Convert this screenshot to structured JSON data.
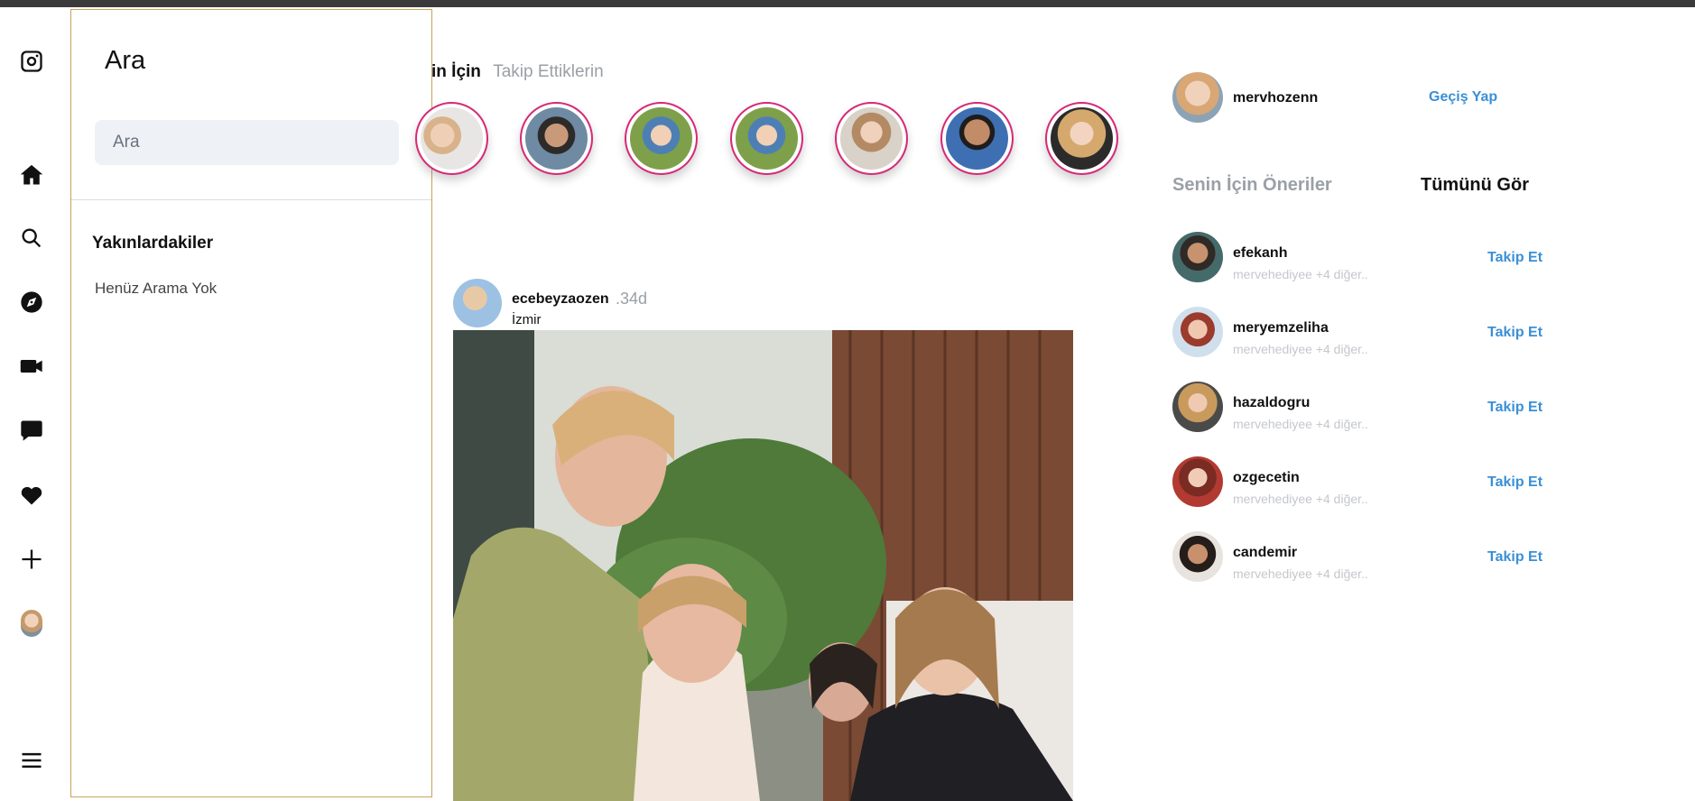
{
  "search_panel": {
    "title": "Ara",
    "search_placeholder": "Ara",
    "recent_title": "Yakınlardakiler",
    "recent_empty": "Henüz Arama Yok"
  },
  "feed_tabs": {
    "for_you": "in İçin",
    "following": "Takip Ettiklerin"
  },
  "post": {
    "username": "ecebeyzaozen",
    "time": ".34d",
    "location": "İzmir"
  },
  "profile": {
    "username": "mervhozenn",
    "switch_label": "Geçiş Yap"
  },
  "suggestions": {
    "title": "Senin İçin Öneriler",
    "see_all": "Tümünü Gör",
    "items": [
      {
        "username": "efekanh",
        "subtitle": "mervehediyee +4 diğer..",
        "action": "Takip Et"
      },
      {
        "username": "meryemzeliha",
        "subtitle": "mervehediyee +4 diğer..",
        "action": "Takip Et"
      },
      {
        "username": "hazaldogru",
        "subtitle": "mervehediyee +4 diğer..",
        "action": "Takip Et"
      },
      {
        "username": "ozgecetin",
        "subtitle": "mervehediyee +4 diğer..",
        "action": "Takip Et"
      },
      {
        "username": "candemir",
        "subtitle": "mervehediyee +4 diğer..",
        "action": "Takip Et"
      }
    ]
  },
  "colors": {
    "story_ring": "#d62976",
    "link_blue": "#3b8fd6",
    "muted_gray": "#9aa0a6"
  },
  "icons": [
    "instagram-icon",
    "home-icon",
    "search-icon",
    "compass-icon",
    "video-icon",
    "message-icon",
    "heart-icon",
    "plus-icon",
    "profile-avatar",
    "menu-icon"
  ]
}
